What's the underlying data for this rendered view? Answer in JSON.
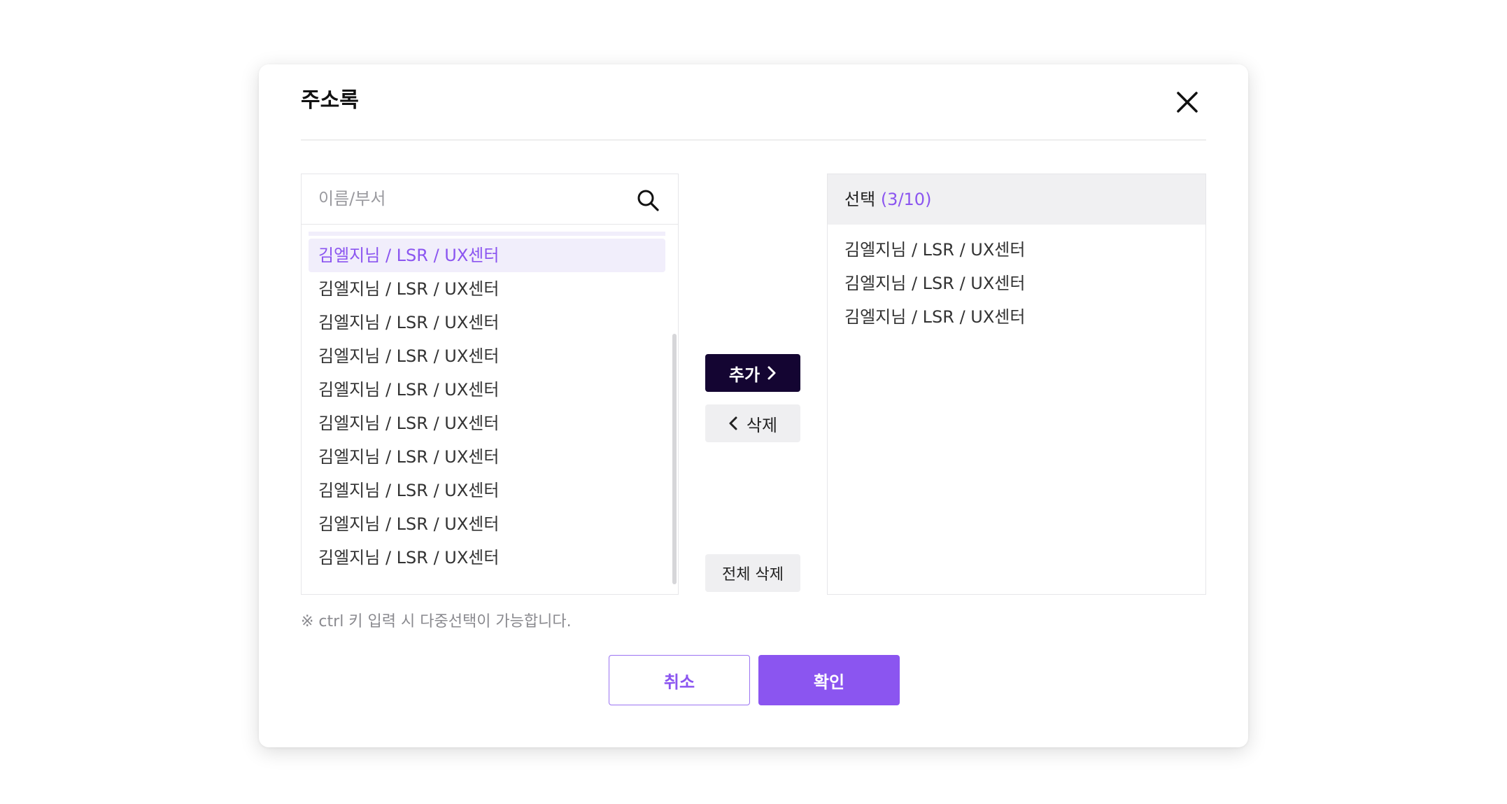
{
  "dialog": {
    "title": "주소록"
  },
  "search": {
    "placeholder": "이름/부서"
  },
  "list": {
    "items": [
      "김엘지님 / LSR / UX센터",
      "김엘지님 / LSR / UX센터",
      "김엘지님 / LSR / UX센터",
      "김엘지님 / LSR / UX센터",
      "김엘지님 / LSR / UX센터",
      "김엘지님 / LSR / UX센터",
      "김엘지님 / LSR / UX센터",
      "김엘지님 / LSR / UX센터",
      "김엘지님 / LSR / UX센터",
      "김엘지님 / LSR / UX센터"
    ],
    "selected_index": 0
  },
  "actions": {
    "add_label": "추가",
    "remove_label": "삭제",
    "remove_all_label": "전체 삭제"
  },
  "selection": {
    "header_label": "선택",
    "count": "(3/10)",
    "items": [
      "김엘지님 / LSR / UX센터",
      "김엘지님 / LSR / UX센터",
      "김엘지님 / LSR / UX센터"
    ]
  },
  "hint": "※ ctrl 키 입력 시 다중선택이 가능합니다.",
  "footer": {
    "cancel_label": "취소",
    "confirm_label": "확인"
  },
  "colors": {
    "accent": "#8b55f0",
    "accent_light": "#f1eefb",
    "dark_button": "#140532",
    "gray_button": "#efeff1"
  },
  "icons": {
    "close": "close-icon",
    "search": "search-icon",
    "chevron_right": "chevron-right-icon",
    "chevron_left": "chevron-left-icon"
  }
}
